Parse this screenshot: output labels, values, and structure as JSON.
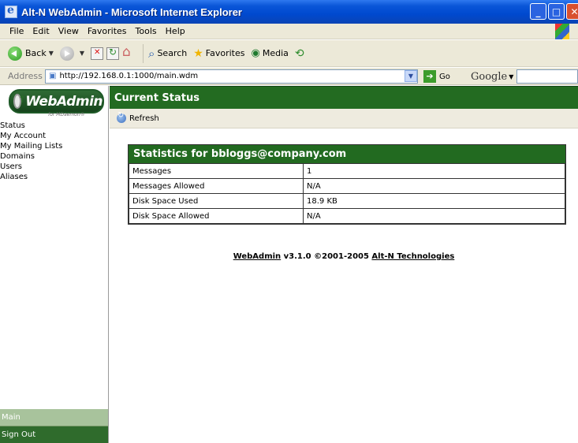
{
  "window": {
    "title": "Alt-N WebAdmin - Microsoft Internet Explorer"
  },
  "menu": {
    "items": [
      "File",
      "Edit",
      "View",
      "Favorites",
      "Tools",
      "Help"
    ]
  },
  "toolbar": {
    "back": "Back",
    "search": "Search",
    "favorites": "Favorites",
    "media": "Media"
  },
  "address": {
    "label": "Address",
    "url": "http://192.168.0.1:1000/main.wdm",
    "go": "Go",
    "search_engine": "Google"
  },
  "sidebar": {
    "logo": "WebAdmin",
    "logo_sub": "for MDaemon®",
    "items": [
      "Status",
      "My Account",
      "My Mailing Lists",
      "Domains",
      "Users",
      "Aliases"
    ],
    "main_label": "Main",
    "signout_label": "Sign Out"
  },
  "main": {
    "header": "Current Status",
    "refresh_label": "Refresh",
    "stats_title": "Statistics for bbloggs@company.com",
    "rows": [
      {
        "label": "Messages",
        "value": "1"
      },
      {
        "label": "Messages Allowed",
        "value": "N/A"
      },
      {
        "label": "Disk Space Used",
        "value": "18.9 KB"
      },
      {
        "label": "Disk Space Allowed",
        "value": "N/A"
      }
    ],
    "footer": {
      "product_link": "WebAdmin",
      "middle": " v3.1.0 ©2001-2005 ",
      "company_link": "Alt-N Technologies"
    }
  }
}
